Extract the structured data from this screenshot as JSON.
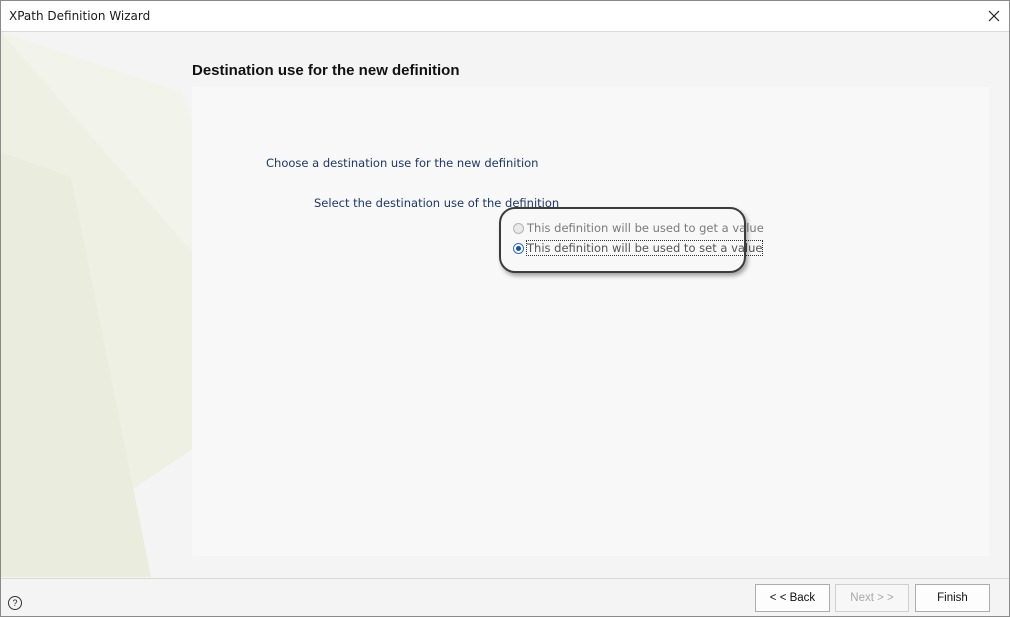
{
  "window": {
    "title": "XPath Definition Wizard"
  },
  "page": {
    "heading": "Destination use for the new definition",
    "intro": "Choose a destination use for the new definition",
    "group_label": "Select the destination use of the definition"
  },
  "options": [
    {
      "label": "This definition will be used to get a value",
      "checked": false,
      "enabled": false
    },
    {
      "label": "This definition will be used to set a value",
      "checked": true,
      "enabled": true
    }
  ],
  "footer": {
    "help_symbol": "?",
    "back_label": "< < Back",
    "next_label": "Next > >",
    "finish_label": "Finish"
  },
  "colors": {
    "accent": "#1b4fa0",
    "text_blue": "#1f3864",
    "decor": "#eeefe3"
  }
}
